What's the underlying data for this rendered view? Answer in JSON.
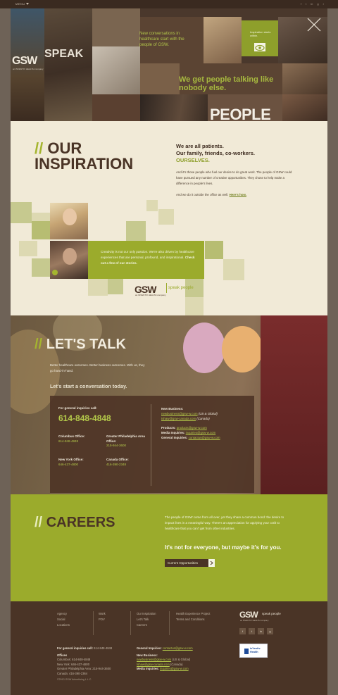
{
  "topbar": {
    "menu_label": "MENU",
    "social": [
      "f",
      "t",
      "in",
      "g",
      "r"
    ]
  },
  "hero": {
    "logo": "GSW",
    "logo_sub": "an INVENTIV HEALTH company",
    "speak": "SPEAK",
    "people": "PEOPLE",
    "conversations": "New conversations in healthcare start with the people of GSW.",
    "talking": "We get people talking like nobody else.",
    "inspiration_box": "Inspiration starts within."
  },
  "inspiration": {
    "title_line1": "OUR",
    "title_line2": "INSPIRATION",
    "lead1": "We are all patients.",
    "lead2": "Our family, friends, co-workers.",
    "lead3": "OURSELVES.",
    "para1": "And it's those people who fuel our desire to do great work. The people of GSW could have pursued any number of creative opportunities. They chose to help make a difference in people's lives.",
    "para2_text": "And we do it outside the office as well.",
    "para2_link": "Here's how.",
    "panel_text": "Creativity is not our only passion. We're also driven by healthcare experiences that are personal, profound, and inspirational.",
    "panel_link": "Check out a few of our stories.",
    "logo": "GSW",
    "logo_word": "speak people",
    "logo_sub": "an INVENTIV HEALTH company"
  },
  "talk": {
    "title": "LET'S TALK",
    "para": "Better healthcare outcomes. Better business outcomes. With us, they go hand-in-hand.",
    "cta": "Let's start a conversation today.",
    "general_label": "For general inquiries call:",
    "general_phone": "614-848-4848",
    "offices": [
      {
        "name": "Columbus Office:",
        "phone": "614-848-4848"
      },
      {
        "name": "Greater Philadelphia Area Office:",
        "phone": "215-944-3600"
      },
      {
        "name": "New York Office:",
        "phone": "646-437-4800"
      },
      {
        "name": "Canada Office:",
        "phone": "416-390-2348"
      }
    ],
    "new_business_label": "New Business:",
    "nb_email1": "newbusiness@gsw-w.com",
    "nb_email1_note": "(US & Global)",
    "nb_email2": "tshaw@gsw-canada.com",
    "nb_email2_note": "(Canada)",
    "products_label": "Products:",
    "products_email": "products@gsw-w.com",
    "media_label": "Media Inquiries:",
    "media_email": "inquiries@gsw-w.com",
    "general_inq_label": "General Inquiries:",
    "general_inq_email": "contactus@gsw-w.com"
  },
  "careers": {
    "title": "CAREERS",
    "para": "The people of GSW come from all over, yet they share a common bond: the desire to impact lives in a meaningful way. There's an appreciation for applying your craft to healthcare that you can't get from other industries.",
    "tagline": "It's not for everyone, but maybe it's for you.",
    "button": "Current Opportunities"
  },
  "footer": {
    "col1": [
      "Agency",
      "Social",
      "Locations"
    ],
    "col2": [
      "Work",
      "POV"
    ],
    "col3": [
      "Our Inspiration",
      "Let's Talk",
      "Careers"
    ],
    "col4": [
      "Health Experience Project",
      "Terms and Conditions"
    ],
    "logo": "GSW",
    "logo_word": "speak people",
    "logo_sub": "an INVENTIV HEALTH company",
    "social": [
      "f",
      "t",
      "in",
      "g"
    ],
    "general_label": "For general inquiries call:",
    "general_phone": "614-848-4848",
    "offices_label": "Offices",
    "offices": [
      "Columbus: 614-848-4848",
      "New York: 646-437-4800",
      "Greater Philadelphia Area: 215-944-3600",
      "Canada: 416-390-2364"
    ],
    "gen_inq_label": "General Inquiries:",
    "gen_inq_email": "contactus@gsw-w.com",
    "nb_label": "New Business:",
    "nb_email1": "newbusiness@gsw-w.com",
    "nb_email1_note": "(US & Global)",
    "nb_email2": "tshaw@gsw-canada.com",
    "nb_email2_note": "(Canada)",
    "media_label": "Media Inquiries:",
    "media_email": "inquiries@gsw-w.com",
    "inventiv_line1": "inVentiv",
    "inventiv_line2": "Health",
    "copyright": "©2013 GSW Advertising L.L.C."
  },
  "colors": {
    "brand_green": "#9bab2c",
    "brand_brown": "#4a3426",
    "cream": "#f1ead7"
  }
}
